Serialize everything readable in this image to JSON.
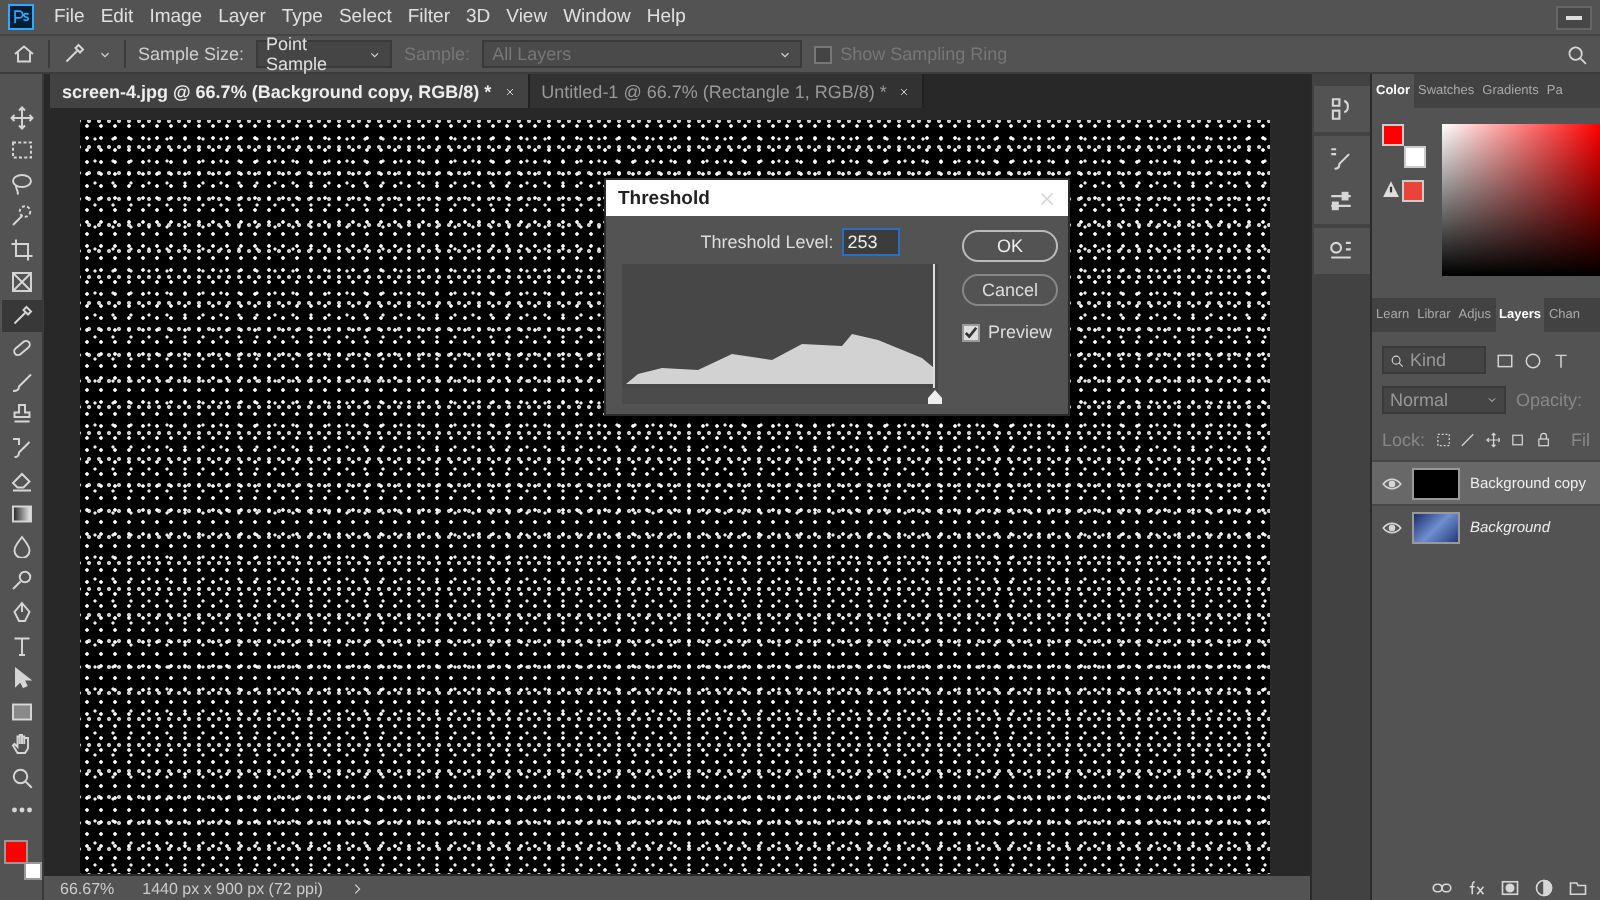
{
  "menu": [
    "File",
    "Edit",
    "Image",
    "Layer",
    "Type",
    "Select",
    "Filter",
    "3D",
    "View",
    "Window",
    "Help"
  ],
  "options_bar": {
    "sample_size_label": "Sample Size:",
    "sample_size": "Point Sample",
    "sample_label": "Sample:",
    "sample": "All Layers",
    "sample_disabled": true,
    "sampling_ring": {
      "label": "Show Sampling Ring",
      "checked": false,
      "disabled": true
    }
  },
  "document_tabs": [
    {
      "label": "screen-4.jpg @ 66.7% (Background copy, RGB/8) *",
      "selected": true
    },
    {
      "label": "Untitled-1 @ 66.7% (Rectangle 1, RGB/8) *",
      "selected": false
    }
  ],
  "tools": [
    {
      "kind": "move",
      "selected": false
    },
    {
      "kind": "marquee",
      "selected": false
    },
    {
      "kind": "lasso",
      "selected": false
    },
    {
      "kind": "quick-select",
      "selected": false
    },
    {
      "kind": "crop",
      "selected": false
    },
    {
      "kind": "frame",
      "selected": false
    },
    {
      "kind": "eyedropper",
      "selected": true
    },
    {
      "kind": "healing",
      "selected": false
    },
    {
      "kind": "brush",
      "selected": false
    },
    {
      "kind": "stamp",
      "selected": false
    },
    {
      "kind": "history-brush",
      "selected": false
    },
    {
      "kind": "eraser",
      "selected": false
    },
    {
      "kind": "gradient",
      "selected": false
    },
    {
      "kind": "blur",
      "selected": false
    },
    {
      "kind": "dodge",
      "selected": false
    },
    {
      "kind": "pen",
      "selected": false
    },
    {
      "kind": "type",
      "selected": false
    },
    {
      "kind": "path-select",
      "selected": false
    },
    {
      "kind": "rectangle",
      "selected": false
    },
    {
      "kind": "hand",
      "selected": false
    },
    {
      "kind": "zoom",
      "selected": false
    },
    {
      "kind": "more",
      "selected": false
    }
  ],
  "tool_colors": [
    {
      "kind": "foreground",
      "color": "#ff0000"
    },
    {
      "kind": "background",
      "color": "#ffffff"
    }
  ],
  "threshold_dialog": {
    "title": "Threshold",
    "level_label": "Threshold Level:",
    "level_value": "253",
    "slider": {
      "level": 0.99
    },
    "buttons": [
      {
        "label": "OK",
        "kind": "primary"
      },
      {
        "label": "Cancel",
        "kind": "secondary"
      }
    ],
    "preview": {
      "label": "Preview",
      "checked": true
    }
  },
  "status_bar": {
    "zoom": "66.67%",
    "dimensions": "1440 px x 900 px (72 ppi)"
  },
  "color_panel": {
    "tabs": [
      {
        "label": "Color",
        "selected": true
      },
      {
        "label": "Swatches",
        "selected": false
      },
      {
        "label": "Gradients",
        "selected": false
      },
      {
        "label": "Pa",
        "selected": false
      }
    ],
    "swatches": [
      {
        "kind": "foreground",
        "color": "#ff0000"
      },
      {
        "kind": "background",
        "color": "#ffffff"
      },
      {
        "kind": "gamut",
        "color": "#e8443a"
      }
    ]
  },
  "layers_panel": {
    "tabs": [
      {
        "label": "Learn",
        "selected": false
      },
      {
        "label": "Librar",
        "selected": false
      },
      {
        "label": "Adjus",
        "selected": false
      },
      {
        "label": "Layers",
        "selected": true
      },
      {
        "label": "Chan",
        "selected": false
      }
    ],
    "filter": "Kind",
    "blend_mode": "Normal",
    "opacity_label": "Opacity:",
    "lock_label": "Lock:",
    "fill_label": "Fil",
    "layers": [
      {
        "name": "Background copy",
        "selected": true,
        "visible": true,
        "locked": false,
        "kind": "solid"
      },
      {
        "name": "Background",
        "selected": false,
        "visible": true,
        "locked": true,
        "kind": "image"
      }
    ]
  }
}
